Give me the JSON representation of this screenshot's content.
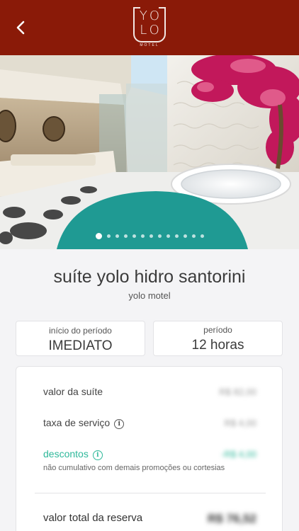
{
  "header": {
    "logo_line1": "YO",
    "logo_line2": "LO",
    "logo_caption": "MOTEL",
    "brand_color": "#8a1a08"
  },
  "gallery": {
    "image_count": 13,
    "current_index": 1
  },
  "suite": {
    "name": "suíte yolo hidro santorini",
    "motel": "yolo motel"
  },
  "period": {
    "start_label": "início do período",
    "start_value": "IMEDIATO",
    "duration_label": "período",
    "duration_value": "12 horas"
  },
  "pricing": {
    "suite_label": "valor da suíte",
    "suite_amount": "R$ 82,00",
    "service_label": "taxa de serviço",
    "service_amount": "R$ 4,00",
    "discount_label": "descontos",
    "discount_amount": "-R$ 4,00",
    "discount_note": "não cumulativo com demais promoções ou cortesias",
    "total_label": "valor total da reserva",
    "total_amount": "R$ 76,52",
    "accent_color": "#2eb89a"
  },
  "icons": {
    "back": "chevron-left-icon",
    "info": "info-icon"
  }
}
